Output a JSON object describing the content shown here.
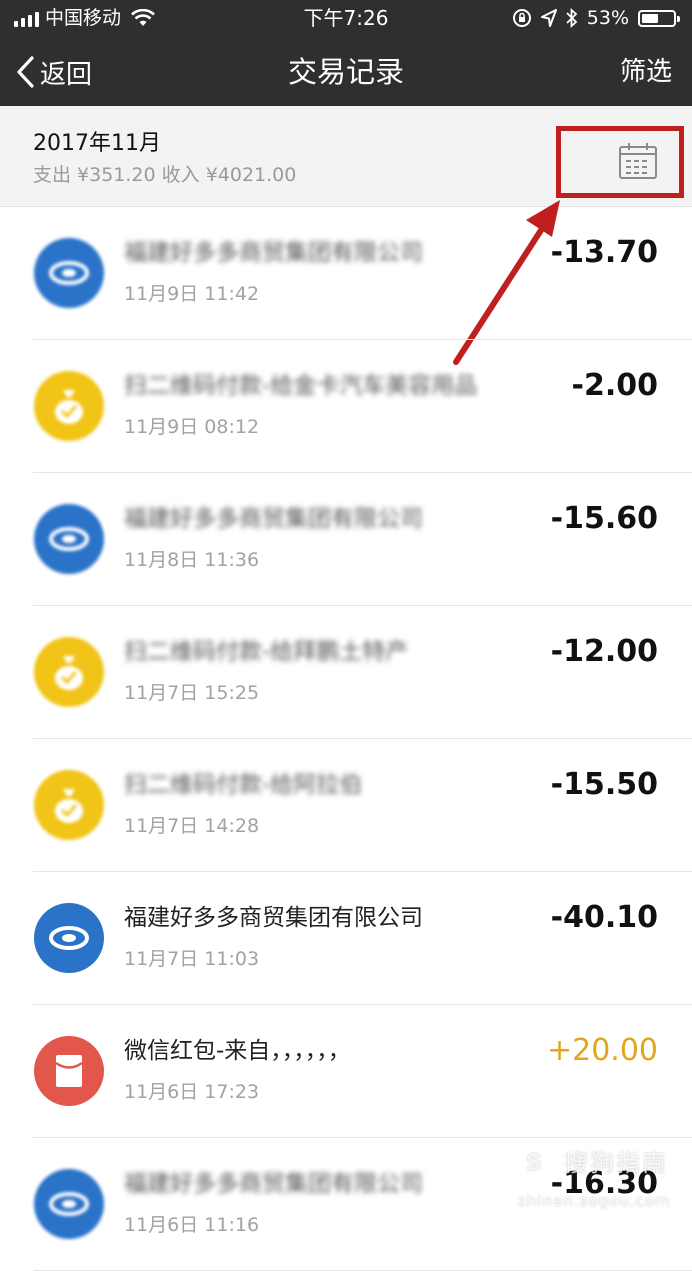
{
  "status_bar": {
    "carrier": "中国移动",
    "time": "下午7:26",
    "battery": "53%",
    "battery_level": 0.53,
    "icons": [
      "signal-icon",
      "wifi-icon",
      "orientation-lock-icon",
      "location-icon",
      "bluetooth-icon",
      "battery-icon"
    ]
  },
  "nav": {
    "back_label": "返回",
    "title": "交易记录",
    "filter_label": "筛选"
  },
  "month": {
    "title": "2017年11月",
    "summary": "支出 ¥351.20 收入 ¥4021.00",
    "calendar_icon": "calendar-icon"
  },
  "annotation": {
    "color": "#c01f1f"
  },
  "colors": {
    "header_bg": "#2f2f30",
    "blue_icon": "#2a73c9",
    "yellow_icon": "#f1c417",
    "red_icon": "#e2564b",
    "income": "#e4a51e"
  },
  "transactions": [
    {
      "title": "福建好多多商贸集团有限公司",
      "date": "11月9日 11:42",
      "amount": "-13.70",
      "icon": "merchant-icon",
      "blurred": true
    },
    {
      "title": "扫二维码付款-给金卡汽车美容用品",
      "date": "11月9日 08:12",
      "amount": "-2.00",
      "icon": "money-bag-icon",
      "blurred": true
    },
    {
      "title": "福建好多多商贸集团有限公司",
      "date": "11月8日 11:36",
      "amount": "-15.60",
      "icon": "merchant-icon",
      "blurred": true
    },
    {
      "title": "扫二维码付款-给拜鹏土特产",
      "date": "11月7日 15:25",
      "amount": "-12.00",
      "icon": "money-bag-icon",
      "blurred": true
    },
    {
      "title": "扫二维码付款-给阿拉伯",
      "date": "11月7日 14:28",
      "amount": "-15.50",
      "icon": "money-bag-icon",
      "blurred": true
    },
    {
      "title": "福建好多多商贸集团有限公司",
      "date": "11月7日 11:03",
      "amount": "-40.10",
      "icon": "merchant-icon",
      "blurred": false
    },
    {
      "title": "微信红包-来自，，，，，，",
      "date": "11月6日 17:23",
      "amount": "+20.00",
      "icon": "red-packet-icon",
      "blurred": false,
      "income": true
    },
    {
      "title": "福建好多多商贸集团有限公司",
      "date": "11月6日 11:16",
      "amount": "-16.30",
      "icon": "merchant-icon",
      "blurred": true
    }
  ],
  "watermark": {
    "logo": "S",
    "text": "搜狗指南",
    "sub": "zhinan.sogou.com"
  }
}
